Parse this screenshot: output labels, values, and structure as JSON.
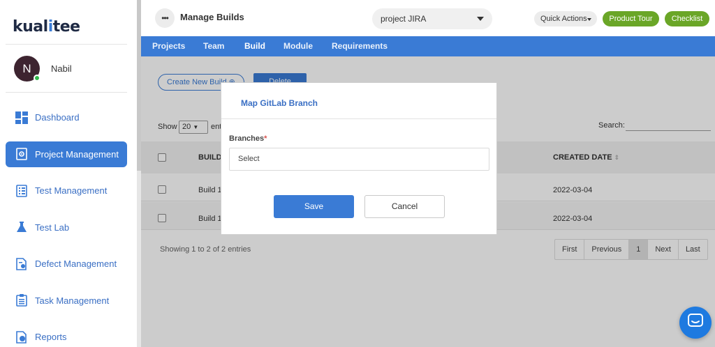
{
  "brand": {
    "logo_pre": "kual",
    "logo_o": "i",
    "logo_post": "tee"
  },
  "user": {
    "initial": "N",
    "name": "Nabil"
  },
  "sidebar": {
    "items": [
      {
        "label": "Dashboard",
        "icon": "dashboard-icon"
      },
      {
        "label": "Project Management",
        "icon": "gear-doc-icon",
        "active": true
      },
      {
        "label": "Test Management",
        "icon": "checklist-icon"
      },
      {
        "label": "Test Lab",
        "icon": "flask-icon"
      },
      {
        "label": "Defect Management",
        "icon": "bug-doc-icon"
      },
      {
        "label": "Task Management",
        "icon": "clipboard-icon"
      },
      {
        "label": "Reports",
        "icon": "report-icon"
      }
    ]
  },
  "header": {
    "menu_glyph": "•••",
    "title": "Manage Builds",
    "project_select": "project JIRA",
    "quick_actions": "Quick Actions",
    "product_tour": "Product Tour",
    "checklist": "Checklist"
  },
  "tabs": [
    "Projects",
    "Team",
    "Build",
    "Module",
    "Requirements"
  ],
  "active_tab": "Build",
  "toolbar": {
    "create_label": "Create New Build",
    "delete_label": "Delete"
  },
  "table_controls": {
    "show_label": "Show",
    "show_value": "20",
    "entries_label": "entries",
    "search_label": "Search:"
  },
  "table": {
    "columns": [
      "BUILD",
      "CREATED DATE"
    ],
    "rows": [
      {
        "build": "Build 1",
        "created": "2022-03-04"
      },
      {
        "build": "Build 1",
        "created": "2022-03-04"
      }
    ]
  },
  "footer": {
    "showing": "Showing 1 to 2 of 2 entries",
    "pager": [
      "First",
      "Previous",
      "1",
      "Next",
      "Last"
    ]
  },
  "modal": {
    "title": "Map GitLab Branch",
    "field_label": "Branches",
    "required_mark": "*",
    "select_value": "Select",
    "save_label": "Save",
    "cancel_label": "Cancel"
  },
  "colors": {
    "brand_blue": "#3a7bd5",
    "green": "#6aa627",
    "chat_blue": "#1e7ae0"
  }
}
